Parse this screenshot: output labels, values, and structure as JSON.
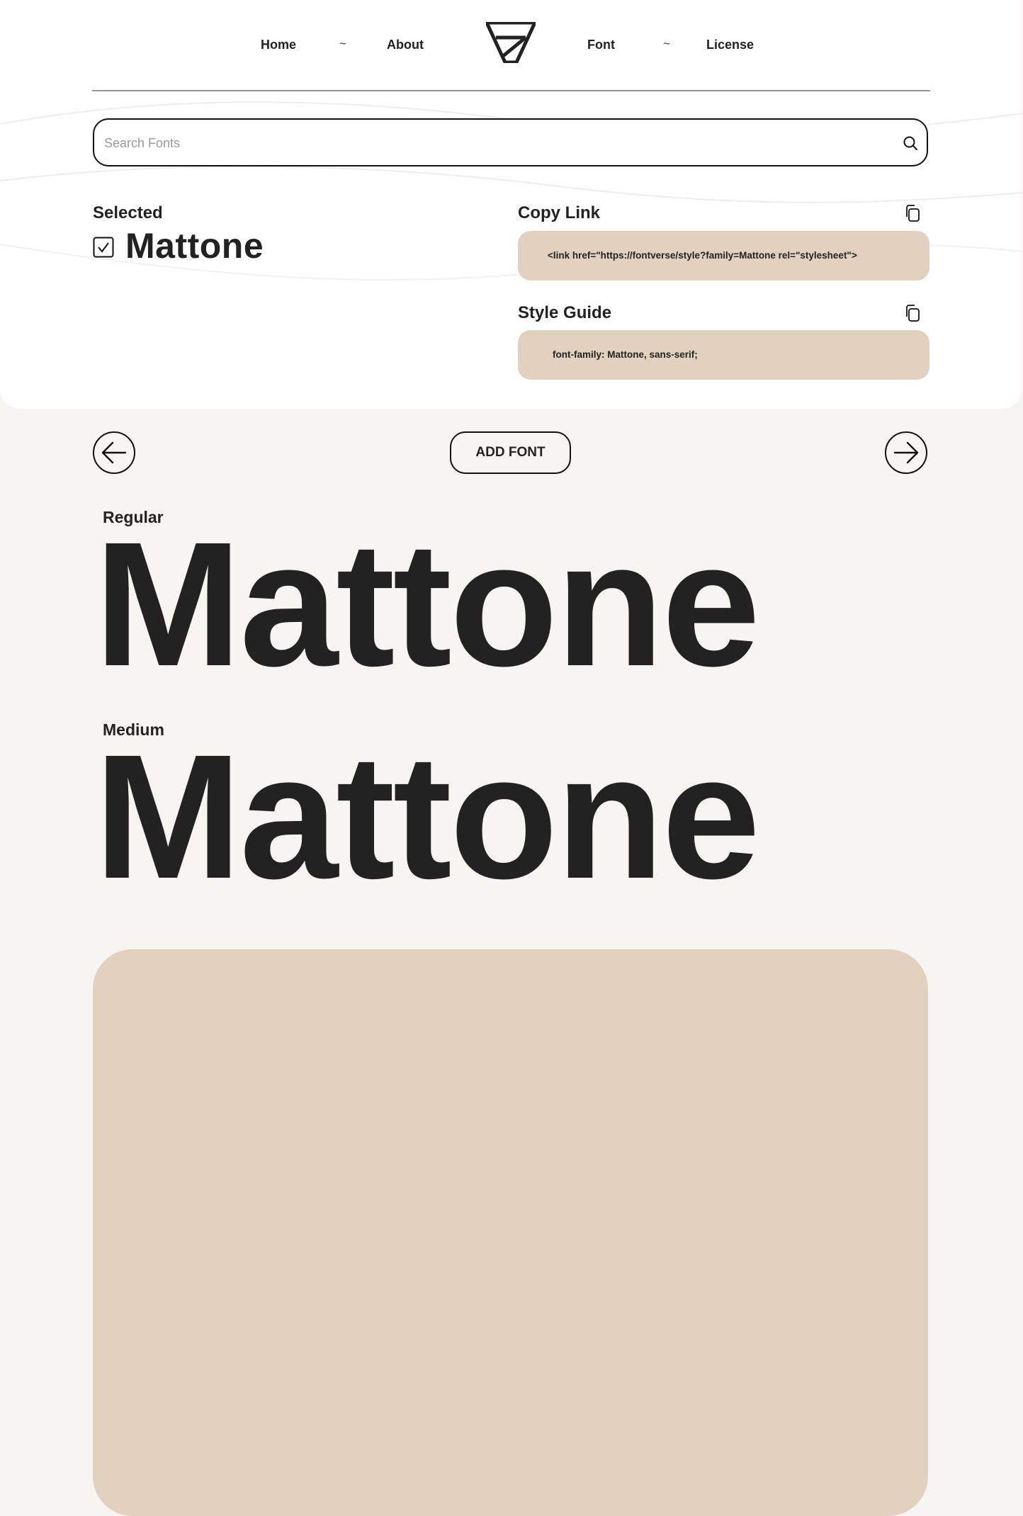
{
  "nav": {
    "links": [
      "Home",
      "About",
      "Font",
      "License"
    ],
    "separator": "~",
    "logo_icon": "fontverse-logo"
  },
  "search": {
    "placeholder": "Search Fonts",
    "value": "",
    "icon": "search-icon"
  },
  "selected": {
    "label": "Selected",
    "checked": true,
    "font_name": "Mattone"
  },
  "copy_link": {
    "label": "Copy Link",
    "code": "<link href=\"https://fontverse/style?family=Mattone rel=\"stylesheet\">",
    "icon": "copy-icon"
  },
  "style_guide": {
    "label": "Style Guide",
    "code": "font-family: Mattone, sans-serif;",
    "icon": "copy-icon"
  },
  "controls": {
    "prev_icon": "arrow-left-icon",
    "add_font_label": "ADD FONT",
    "next_icon": "arrow-right-icon"
  },
  "specimens": [
    {
      "style": "Regular",
      "sample": "Mattone"
    },
    {
      "style": "Medium",
      "sample": "Mattone"
    }
  ],
  "colors": {
    "accent": "#e2d1bf",
    "text": "#222222",
    "background": "#f6f5f2",
    "panel": "#ffffff"
  }
}
